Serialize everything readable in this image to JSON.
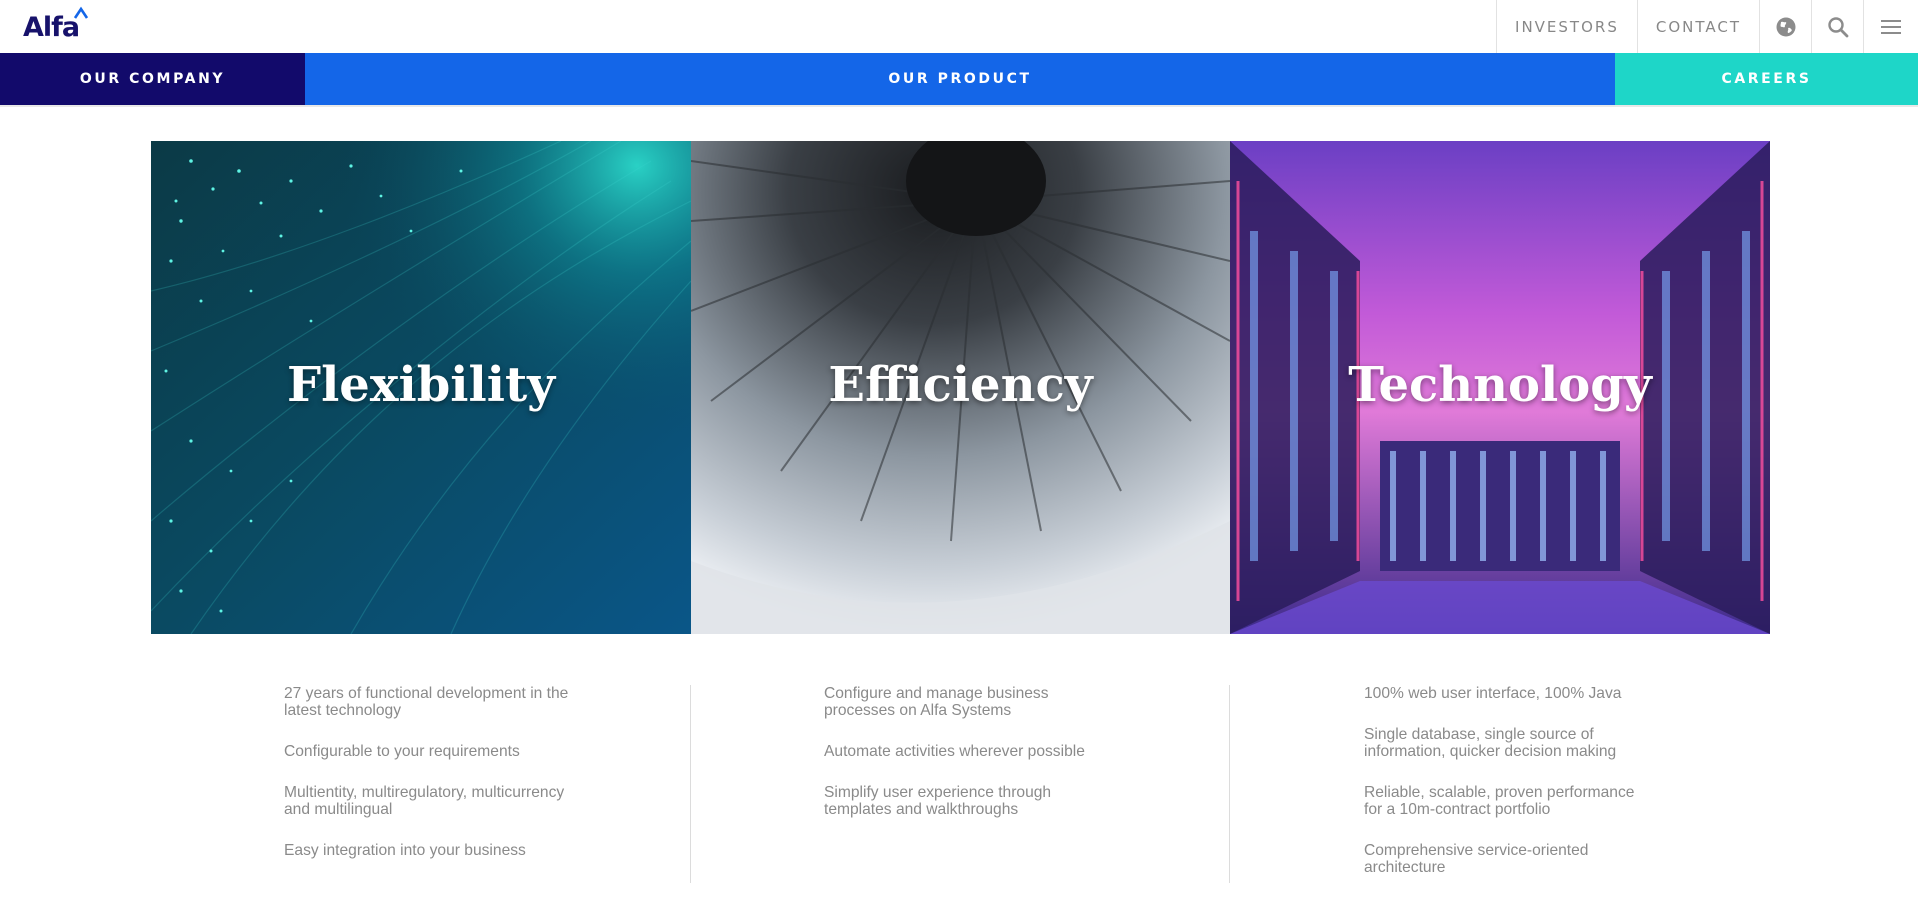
{
  "brand": {
    "logo_text": "Alfa"
  },
  "header": {
    "links": [
      "INVESTORS",
      "CONTACT"
    ],
    "icons": [
      "globe-icon",
      "search-icon",
      "menu-icon"
    ]
  },
  "nav": {
    "items": [
      {
        "label": "OUR COMPANY",
        "color": "#120a6b"
      },
      {
        "label": "OUR PRODUCT",
        "color": "#1466e8"
      },
      {
        "label": "CAREERS",
        "color": "#1ed6c8"
      }
    ]
  },
  "panels": [
    {
      "title": "Flexibility",
      "features": [
        "27 years of functional development in the latest technology",
        "Configurable to your requirements",
        "Multientity, multiregulatory, multicurrency and multilingual",
        "Easy integration into your business"
      ]
    },
    {
      "title": "Efficiency",
      "features": [
        "Configure and manage business processes on Alfa Systems",
        "Automate activities wherever possible",
        "Simplify user experience through templates and walkthroughs"
      ]
    },
    {
      "title": "Technology",
      "features": [
        "100% web user interface, 100% Java",
        "Single database, single source of information, quicker decision making",
        "Reliable, scalable, proven performance for a 10m-contract portfolio",
        "Comprehensive service-oriented architecture"
      ]
    }
  ]
}
